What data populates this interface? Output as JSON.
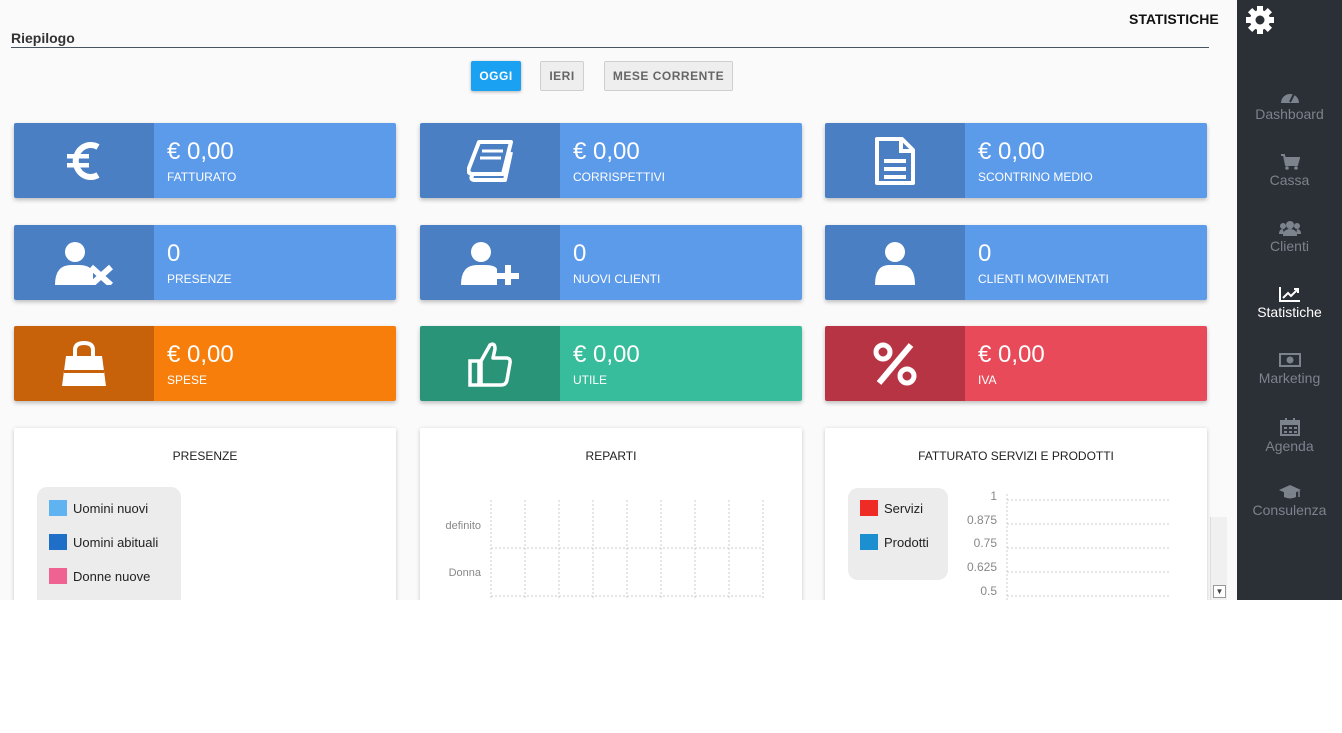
{
  "header": {
    "title": "STATISTICHE",
    "settings_icon": "gear-icon"
  },
  "section": {
    "title": "Riepilogo"
  },
  "filters": [
    {
      "label": "OGGI",
      "active": true
    },
    {
      "label": "IERI",
      "active": false
    },
    {
      "label": "MESE CORRENTE",
      "active": false
    }
  ],
  "cards": [
    {
      "value": "€ 0,00",
      "label": "FATTURATO",
      "icon": "euro-icon",
      "color": "#5c9aea"
    },
    {
      "value": "€ 0,00",
      "label": "CORRISPETTIVI",
      "icon": "book-icon",
      "color": "#5c9aea"
    },
    {
      "value": "€ 0,00",
      "label": "SCONTRINO MEDIO",
      "icon": "document-icon",
      "color": "#5c9aea"
    },
    {
      "value": "0",
      "label": "PRESENZE",
      "icon": "user-remove-icon",
      "color": "#5c9aea"
    },
    {
      "value": "0",
      "label": "NUOVI CLIENTI",
      "icon": "user-add-icon",
      "color": "#5c9aea"
    },
    {
      "value": "0",
      "label": "CLIENTI MOVIMENTATI",
      "icon": "user-icon",
      "color": "#5c9aea"
    },
    {
      "value": "€ 0,00",
      "label": "SPESE",
      "icon": "shopping-bag-icon",
      "color": "#f77e0b"
    },
    {
      "value": "€ 0,00",
      "label": "UTILE",
      "icon": "thumbs-up-icon",
      "color": "#37bd9b"
    },
    {
      "value": "€ 0,00",
      "label": "IVA",
      "icon": "percent-icon",
      "color": "#e84a5a"
    }
  ],
  "panels": {
    "presenze": {
      "title": "PRESENZE",
      "legend": [
        {
          "name": "Uomini nuovi",
          "color": "#5fb3f0"
        },
        {
          "name": "Uomini abituali",
          "color": "#1f6fc9"
        },
        {
          "name": "Donne nuove",
          "color": "#f06292"
        }
      ]
    },
    "reparti": {
      "title": "REPARTI",
      "categories": [
        "definito",
        "Donna"
      ]
    },
    "fatturato": {
      "title": "FATTURATO SERVIZI E PRODOTTI",
      "legend": [
        {
          "name": "Servizi",
          "color": "#ee2b24"
        },
        {
          "name": "Prodotti",
          "color": "#1b8fd0"
        }
      ],
      "ticks": [
        "1",
        "0.875",
        "0.75",
        "0.625",
        "0.5"
      ]
    }
  },
  "chart_data": [
    {
      "type": "bar",
      "title": "PRESENZE",
      "series": [
        {
          "name": "Uomini nuovi",
          "values": []
        },
        {
          "name": "Uomini abituali",
          "values": []
        },
        {
          "name": "Donne nuove",
          "values": []
        }
      ]
    },
    {
      "type": "bar",
      "title": "REPARTI",
      "categories": [
        "definito",
        "Donna"
      ],
      "values": []
    },
    {
      "type": "bar",
      "title": "FATTURATO SERVIZI E PRODOTTI",
      "series": [
        {
          "name": "Servizi",
          "values": []
        },
        {
          "name": "Prodotti",
          "values": []
        }
      ],
      "yticks": [
        1,
        0.875,
        0.75,
        0.625,
        0.5
      ]
    }
  ],
  "sidebar": {
    "items": [
      {
        "label": "Dashboard",
        "icon": "dashboard-icon",
        "active": false
      },
      {
        "label": "Cassa",
        "icon": "cart-icon",
        "active": false
      },
      {
        "label": "Clienti",
        "icon": "users-icon",
        "active": false
      },
      {
        "label": "Statistiche",
        "icon": "chart-line-icon",
        "active": true
      },
      {
        "label": "Marketing",
        "icon": "money-icon",
        "active": false
      },
      {
        "label": "Agenda",
        "icon": "calendar-icon",
        "active": false
      },
      {
        "label": "Consulenza",
        "icon": "graduation-cap-icon",
        "active": false
      }
    ]
  }
}
